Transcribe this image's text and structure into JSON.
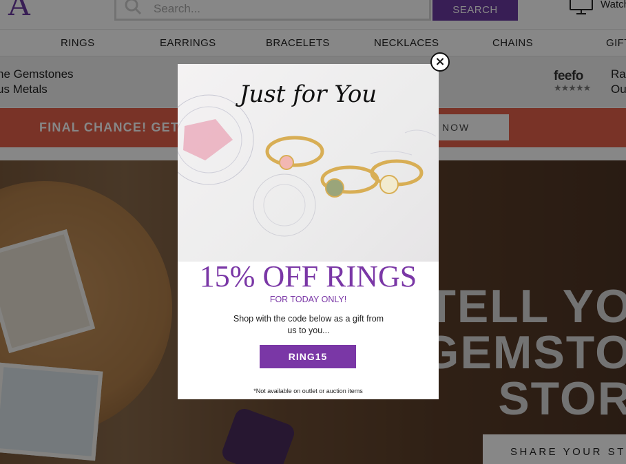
{
  "header": {
    "logo_text": "A",
    "search": {
      "placeholder": "Search...",
      "button_label": "SEARCH"
    },
    "watch_label": "Watch",
    "icons": [
      "search-icon",
      "tv-icon"
    ]
  },
  "nav": {
    "items": [
      {
        "label": "RINGS"
      },
      {
        "label": "EARRINGS"
      },
      {
        "label": "BRACELETS"
      },
      {
        "label": "NECKLACES"
      },
      {
        "label": "CHAINS"
      },
      {
        "label": "GIFT"
      }
    ]
  },
  "trust_bar": {
    "left_lines": [
      "ne Gemstones",
      "us Metals"
    ],
    "feefo_logo": "feefo",
    "feefo_stars": "★★★★★",
    "right_lines": [
      "Ra",
      "Ou"
    ]
  },
  "promo_banner": {
    "text": "FINAL CHANCE! GET",
    "button_label": "NOW"
  },
  "hero": {
    "title_lines": [
      "TELL YO",
      "GEMSTO",
      "STOR"
    ],
    "button_label": "SHARE YOUR STO"
  },
  "popup": {
    "heading": "Just for You",
    "offer": "15% OFF RINGS",
    "subtitle": "FOR TODAY ONLY!",
    "body_lines": [
      "Shop with the code below as a gift from",
      "us to you..."
    ],
    "code_button_label": "RING15",
    "disclaimer": "*Not available on outlet or auction items",
    "close_symbol": "×"
  },
  "colors": {
    "brand_purple": "#6b3aa0",
    "popup_purple": "#7a37a6",
    "promo_coral": "#e5604b",
    "overlay": "rgba(0,0,0,0.47)"
  }
}
